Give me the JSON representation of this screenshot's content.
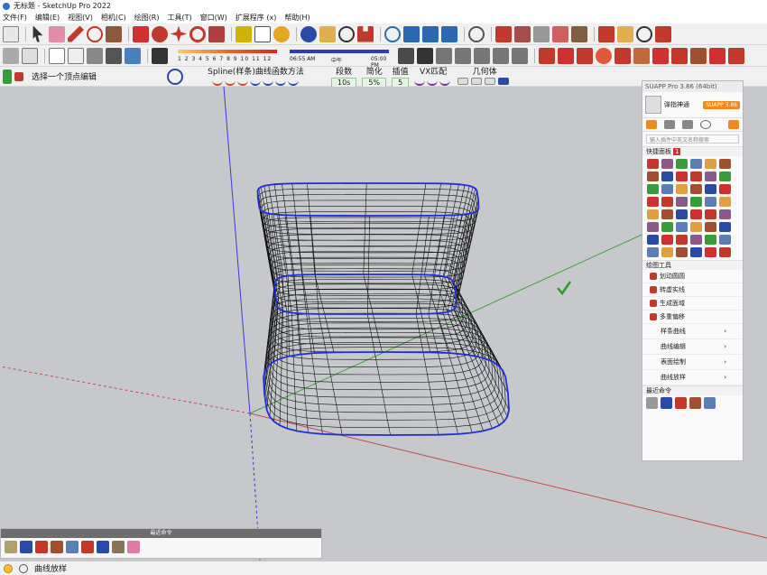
{
  "window": {
    "title": "无标题 - SketchUp Pro 2022"
  },
  "menu": [
    "文件(F)",
    "编辑(E)",
    "视图(V)",
    "相机(C)",
    "绘图(R)",
    "工具(T)",
    "窗口(W)",
    "扩展程序 (x)",
    "帮助(H)"
  ],
  "shadow_bar": {
    "months": "1 2 3 4 5 6 7 8 9 10 11 12",
    "time_start": "06:55 AM",
    "time_mid": "中午",
    "time_end": "05:00 PM"
  },
  "prompt": "选择一个顶点编辑",
  "spline": {
    "title": "Spline(样条)曲线函数方法",
    "segments_label": "段数",
    "segments_value": "10s",
    "simplify_label": "简化",
    "simplify_value": "5%",
    "interp_label": "插值",
    "interp_value": "5",
    "vx_label": "VX匹配",
    "geometry_label": "几何体"
  },
  "suapp": {
    "title": "SUAPP Pro 3.86 (64bit)",
    "user_name": "弹指神通",
    "badge": "SUAPP 3.86",
    "search_placeholder": "输入插件中英文名称搜索",
    "quick_panel": "快捷面板",
    "quick_badge": "1",
    "draw_tools": "绘图工具",
    "list_items": [
      "划动圆圆",
      "转虚实线",
      "生成面域",
      "多重偏移"
    ],
    "sub_buttons": [
      "样条曲线",
      "曲线编辑",
      "表面绘制",
      "曲线放样"
    ],
    "recent": "最近命令"
  },
  "recent_panel": {
    "title": "最近命令"
  },
  "status": {
    "text": "曲线放样"
  },
  "colors": {
    "accent": "#1f2fd6",
    "axis_red": "#c84a4a",
    "axis_green": "#3fa33f",
    "axis_blue": "#3a3ae0",
    "mesh": "#101010",
    "checkmark": "#2e9a2e"
  }
}
